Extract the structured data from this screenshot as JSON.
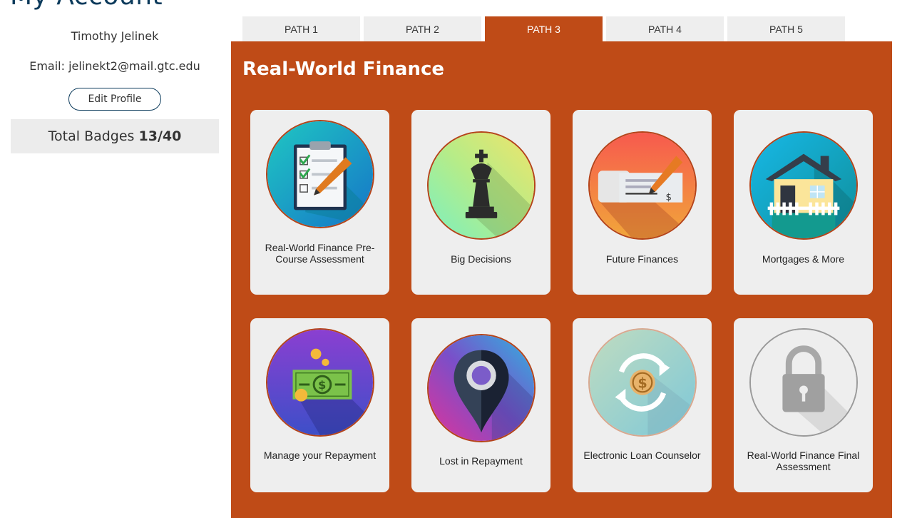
{
  "page": {
    "title": "My Account"
  },
  "profile": {
    "name": "Timothy Jelinek",
    "email": "Email: jelinekt2@mail.gtc.edu",
    "edit_label": "Edit Profile",
    "badges_label": "Total Badges",
    "badges_value": "13/40"
  },
  "tabs": [
    {
      "label": "PATH 1",
      "active": false
    },
    {
      "label": "PATH 2",
      "active": false
    },
    {
      "label": "PATH 3",
      "active": true
    },
    {
      "label": "PATH 4",
      "active": false
    },
    {
      "label": "PATH 5",
      "active": false
    }
  ],
  "panel": {
    "title": "Real-World Finance",
    "color": "#bf4b17",
    "badges": [
      {
        "label": "Real-World Finance Pre-Course Assessment",
        "icon": "clipboard-checklist-icon",
        "earned": true
      },
      {
        "label": "Big Decisions",
        "icon": "chess-king-icon",
        "earned": true
      },
      {
        "label": "Future Finances",
        "icon": "check-pen-icon",
        "earned": true
      },
      {
        "label": "Mortgages & More",
        "icon": "house-icon",
        "earned": true
      },
      {
        "label": "Manage your Repayment",
        "icon": "money-bill-icon",
        "earned": true
      },
      {
        "label": "Lost in Repayment",
        "icon": "map-pin-icon",
        "earned": true
      },
      {
        "label": "Electronic Loan Counselor",
        "icon": "dollar-cycle-icon",
        "earned": true
      },
      {
        "label": "Real-World Finance Final Assessment",
        "icon": "padlock-icon",
        "earned": false
      }
    ]
  }
}
